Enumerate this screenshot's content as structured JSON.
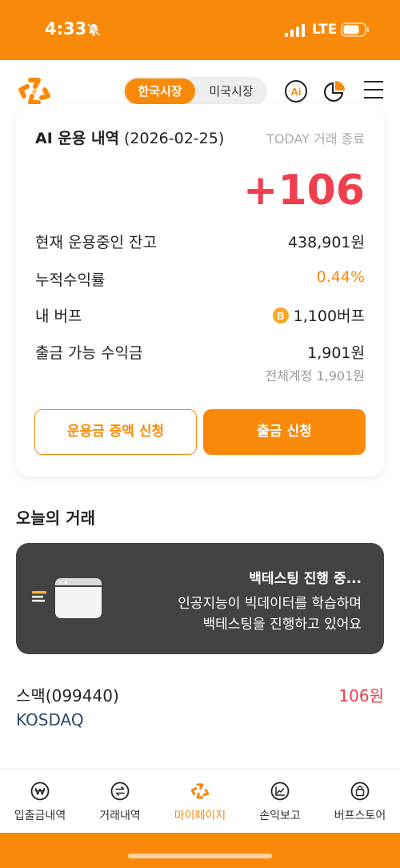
{
  "status_bar": {
    "time": "4:33",
    "network": "LTE"
  },
  "header": {
    "market_tabs": [
      {
        "label": "한국시장",
        "active": true
      },
      {
        "label": "미국시장",
        "active": false
      }
    ],
    "ai_icon_text": "Ai"
  },
  "summary": {
    "title_bold": "AI 운용 내역",
    "title_date": "(2026-02-25)",
    "today_status": "TODAY 거래 종료",
    "profit": "+106",
    "rows": [
      {
        "label": "현재 운용중인 잔고",
        "value": "438,901원"
      },
      {
        "label": "누적수익률",
        "value": "0.44%"
      },
      {
        "label": "내 버프",
        "value": "1,100버프"
      },
      {
        "label": "출금 가능 수익금",
        "value": "1,901원"
      }
    ],
    "total_account": "전체계정 1,901원",
    "buttons": {
      "increase": "운용금 증액 신청",
      "withdraw": "출금 신청"
    }
  },
  "today_trades": {
    "section_title": "오늘의 거래",
    "banner": {
      "title": "백테스팅 진행 중...",
      "line1": "인공지능이 빅데이터를 학습하며",
      "line2": "백테스팅을 진행하고 있어요"
    },
    "stock": {
      "name": "스맥(099440)",
      "market": "KOSDAQ",
      "profit": "106원"
    }
  },
  "bottom_nav": [
    {
      "label": "입출금내역",
      "icon": "won-coin-icon",
      "active": false
    },
    {
      "label": "거래내역",
      "icon": "exchange-icon",
      "active": false
    },
    {
      "label": "마이페이지",
      "icon": "brand-logo-icon",
      "active": true
    },
    {
      "label": "손익보고",
      "icon": "chart-icon",
      "active": false
    },
    {
      "label": "버프스토어",
      "icon": "shopping-bag-icon",
      "active": false
    }
  ],
  "colors": {
    "brand": "#f98a09",
    "profit_red": "#ef3f4f",
    "banner_bg": "#434343",
    "market_text": "#2b4a6a"
  }
}
